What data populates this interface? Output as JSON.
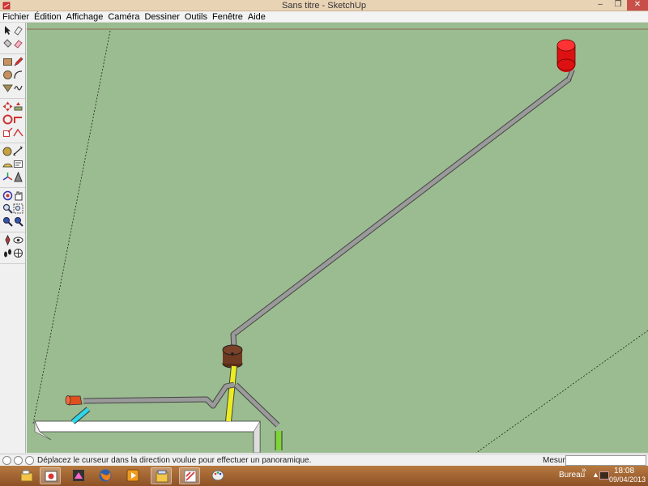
{
  "window": {
    "title": "Sans titre - SketchUp",
    "minimize_label": "–",
    "maximize_label": "❐",
    "close_label": "✕"
  },
  "menu": [
    "Fichier",
    "Édition",
    "Affichage",
    "Caméra",
    "Dessiner",
    "Outils",
    "Fenêtre",
    "Aide"
  ],
  "toolbar": {
    "tools": [
      "select-icon",
      "eraser-icon",
      "paint-bucket-icon",
      "eraser-pink-icon",
      "rectangle-icon",
      "pencil-icon",
      "circle-icon",
      "arc-icon",
      "polygon-icon",
      "freehand-icon",
      "move-icon",
      "push-pull-icon",
      "rotate-icon",
      "follow-me-icon",
      "scale-icon",
      "offset-icon",
      "tape-measure-icon",
      "dimension-icon",
      "protractor-icon",
      "text-icon",
      "axes-icon",
      "3d-text-icon",
      "orbit-icon",
      "pan-icon",
      "zoom-icon",
      "zoom-window-icon",
      "zoom-extents-icon",
      "previous-view-icon",
      "position-camera-icon",
      "look-around-icon",
      "walk-icon",
      "section-plane-icon"
    ]
  },
  "viewport": {
    "background_color": "#9bbc90"
  },
  "statusbar": {
    "hint": "Déplacez le curseur dans la direction voulue pour effectuer un panoramique.",
    "measure_label": "Mesures",
    "measure_value": ""
  },
  "taskbar": {
    "apps": [
      "file-explorer-icon",
      "photo-app-icon",
      "firefox-icon",
      "media-player-icon",
      "folder-icon",
      "sketchup-icon",
      "paint-icon"
    ],
    "tray_label": "Bureau",
    "tray_chevron": "»",
    "tray_arrow": "▲",
    "time": "18:08",
    "date": "09/04/2013"
  }
}
